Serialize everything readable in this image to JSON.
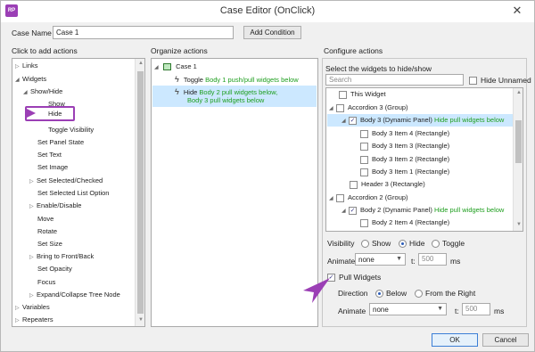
{
  "window": {
    "title": "Case Editor (OnClick)",
    "icon": "app-icon",
    "close": "✕"
  },
  "case_name": {
    "label": "Case Name",
    "value": "Case 1",
    "add_condition": "Add Condition"
  },
  "left": {
    "header": "Click to add actions",
    "items": [
      {
        "label": "Links",
        "expander": "▷"
      },
      {
        "label": "Widgets",
        "expander": "◢"
      },
      {
        "label": "Show/Hide",
        "expander": "◢"
      },
      {
        "label": "Show"
      },
      {
        "label": "Hide"
      },
      {
        "label": "Toggle Visibility"
      },
      {
        "label": "Set Panel State"
      },
      {
        "label": "Set Text"
      },
      {
        "label": "Set Image"
      },
      {
        "label": "Set Selected/Checked",
        "expander": "▷"
      },
      {
        "label": "Set Selected List Option"
      },
      {
        "label": "Enable/Disable",
        "expander": "▷"
      },
      {
        "label": "Move"
      },
      {
        "label": "Rotate"
      },
      {
        "label": "Set Size"
      },
      {
        "label": "Bring to Front/Back",
        "expander": "▷"
      },
      {
        "label": "Set Opacity"
      },
      {
        "label": "Focus"
      },
      {
        "label": "Expand/Collapse Tree Node",
        "expander": "▷"
      },
      {
        "label": "Variables",
        "expander": "▷"
      },
      {
        "label": "Repeaters",
        "expander": "▷"
      }
    ]
  },
  "middle": {
    "header": "Organize actions",
    "case_label": "Case 1",
    "case_expander": "◢",
    "actions": [
      {
        "verb": "Toggle",
        "detail": "Body 1 push/pull widgets below"
      },
      {
        "verb": "Hide",
        "detail": "Body 2 pull widgets below,",
        "detail2": "Body 3 pull widgets below"
      }
    ]
  },
  "right": {
    "header": "Configure actions",
    "select_label": "Select the widgets to hide/show",
    "search_placeholder": "Search",
    "hide_unnamed": "Hide Unnamed",
    "widgets": [
      {
        "label": "This Widget",
        "checked": ""
      },
      {
        "label": "Accordion 3 (Group)",
        "checked": "",
        "expander": "◢"
      },
      {
        "label": "Body 3 (Dynamic Panel)",
        "checked": "✓",
        "note": "Hide pull widgets below",
        "expander": "◢"
      },
      {
        "label": "Body 3 Item 4 (Rectangle)",
        "checked": ""
      },
      {
        "label": "Body 3 Item 3 (Rectangle)",
        "checked": ""
      },
      {
        "label": "Body 3 Item 2 (Rectangle)",
        "checked": ""
      },
      {
        "label": "Body 3 Item 1 (Rectangle)",
        "checked": ""
      },
      {
        "label": "Header 3 (Rectangle)",
        "checked": ""
      },
      {
        "label": "Accordion 2 (Group)",
        "checked": "",
        "expander": "◢"
      },
      {
        "label": "Body 2 (Dynamic Panel)",
        "checked": "✓",
        "note": "Hide pull widgets below",
        "expander": "◢"
      },
      {
        "label": "Body 2 Item 4 (Rectangle)",
        "checked": ""
      }
    ],
    "visibility": {
      "label": "Visibility",
      "options": [
        "Show",
        "Hide",
        "Toggle"
      ],
      "selected": "Hide"
    },
    "animate": {
      "label": "Animate",
      "value": "none",
      "t_label": "t:",
      "t_value": "500",
      "unit": "ms"
    },
    "pull": {
      "label": "Pull Widgets",
      "checked": "✓"
    },
    "direction": {
      "label": "Direction",
      "options": [
        "Below",
        "From the Right"
      ],
      "selected": "Below"
    },
    "animate2": {
      "label": "Animate",
      "value": "none",
      "t_label": "t:",
      "t_value": "500",
      "unit": "ms"
    }
  },
  "footer": {
    "ok": "OK",
    "cancel": "Cancel"
  },
  "colors": {
    "accent": "#9b3fb5",
    "highlight": "#cce8ff",
    "note_green": "#1e9e1e"
  }
}
